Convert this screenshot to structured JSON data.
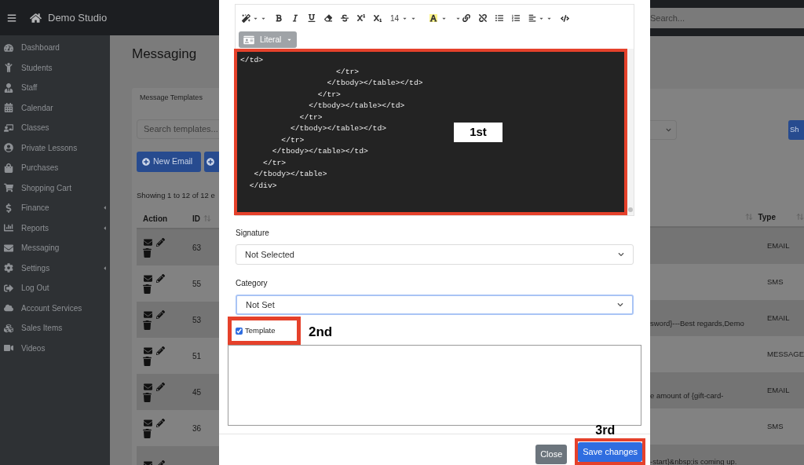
{
  "navbar": {
    "brand": "Demo Studio",
    "search_placeholder": "Search..."
  },
  "sidebar": {
    "items": [
      {
        "label": "Dashboard",
        "has_submenu": false
      },
      {
        "label": "Students",
        "has_submenu": false
      },
      {
        "label": "Staff",
        "has_submenu": false
      },
      {
        "label": "Calendar",
        "has_submenu": false
      },
      {
        "label": "Classes",
        "has_submenu": false
      },
      {
        "label": "Private Lessons",
        "has_submenu": false
      },
      {
        "label": "Purchases",
        "has_submenu": false
      },
      {
        "label": "Shopping Cart",
        "has_submenu": false
      },
      {
        "label": "Finance",
        "has_submenu": true
      },
      {
        "label": "Reports",
        "has_submenu": true
      },
      {
        "label": "Messaging",
        "has_submenu": false
      },
      {
        "label": "Settings",
        "has_submenu": true
      },
      {
        "label": "Log Out",
        "has_submenu": false
      },
      {
        "label": "Account Services",
        "has_submenu": false
      },
      {
        "label": "Sales Items",
        "has_submenu": false
      },
      {
        "label": "Videos",
        "has_submenu": false
      }
    ]
  },
  "page": {
    "title": "Messaging",
    "tab": "Message Templates",
    "search_placeholder": "Search templates...",
    "new_button": "New Email",
    "right_button": "Sh",
    "entries_info": "Showing 1 to 12 of 12 e",
    "table": {
      "columns": [
        {
          "label": "Action"
        },
        {
          "label": "ID"
        },
        {
          "label": "Type"
        }
      ],
      "rows": [
        {
          "id": "63",
          "type": "EMAIL"
        },
        {
          "id": "55",
          "type": "SMS"
        },
        {
          "id": "53",
          "preview": "sword}---Best regards,Demo",
          "type": "EMAIL"
        },
        {
          "id": "51",
          "type": "MESSAGE"
        },
        {
          "id": "45",
          "preview": "e amount of {gift-card-",
          "type": "EMAIL"
        },
        {
          "id": "36",
          "type": "SMS"
        },
        {
          "preview": "-start}&nbsp;is coming up."
        }
      ]
    }
  },
  "modal": {
    "editor": {
      "font_size": "14",
      "style_button": "Literal",
      "code_lines": [
        "</td>",
        "                     </tr>",
        "                   </tbody></table></td>",
        "                 </tr>",
        "               </tbody></table></td>",
        "             </tr>",
        "           </tbody></table></td>",
        "         </tr>",
        "       </tbody></table></td>",
        "     </tr>",
        "   </tbody></table>",
        "  </div>"
      ]
    },
    "signature": {
      "label": "Signature",
      "value": "Not Selected",
      "focused": false
    },
    "category": {
      "label": "Category",
      "value": "Not Set",
      "focused": true
    },
    "template": {
      "label": "Template",
      "checked": true
    },
    "buttons": [
      {
        "label": "Close",
        "kind": "secondary"
      },
      {
        "label": "Save changes",
        "kind": "primary"
      }
    ]
  },
  "annotations": [
    "1st",
    "2nd",
    "3rd"
  ]
}
